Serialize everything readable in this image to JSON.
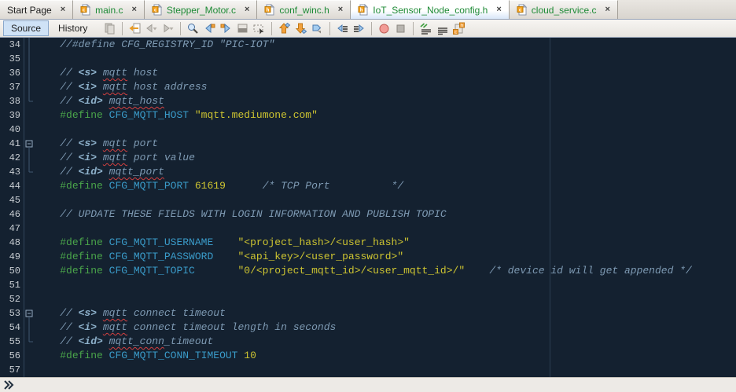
{
  "window_title": "MPLAB X IDE editor",
  "tabs": [
    {
      "label": "Start Page",
      "file_type": "none",
      "active": false,
      "close_label": "x"
    },
    {
      "label": "main.c",
      "file_type": "c",
      "active": false,
      "close_label": "x"
    },
    {
      "label": "Stepper_Motor.c",
      "file_type": "c",
      "active": false,
      "close_label": "x"
    },
    {
      "label": "conf_winc.h",
      "file_type": "h",
      "active": false,
      "close_label": "x"
    },
    {
      "label": "IoT_Sensor_Node_config.h",
      "file_type": "h",
      "active": true,
      "close_label": "x"
    },
    {
      "label": "cloud_service.c",
      "file_type": "c",
      "active": false,
      "close_label": "x"
    }
  ],
  "toolbar": {
    "source_label": "Source",
    "history_label": "History",
    "icons": [
      "diff",
      "sep",
      "last-edit-location",
      "back",
      "forward",
      "sep",
      "find",
      "find-previous",
      "find-next",
      "toggle-highlight-search",
      "rectangular-selection",
      "sep",
      "previous-bookmark",
      "next-bookmark",
      "toggle-bookmark",
      "sep",
      "shift-left",
      "shift-right",
      "sep",
      "start-macro-recording",
      "stop-macro-recording",
      "sep",
      "comment",
      "uncomment",
      "toggle-header-source"
    ]
  },
  "colors": {
    "editor_background": "#142130",
    "comment": "#7e9ab3",
    "keyword": "#4aa54a",
    "macro_name": "#3a9bc9",
    "string_number": "#cdc431",
    "spell_error": "#d34040",
    "tab_modified_text": "#1d8a35",
    "active_tab_highlight": "#d8e6f8"
  },
  "editor": {
    "first_line": 34,
    "last_line": 57,
    "lines": [
      {
        "n": 34,
        "fold": "g",
        "segs": [
          {
            "t": "    //#define CFG_REGISTRY_ID \"PIC-IOT\"",
            "c": "cm"
          }
        ]
      },
      {
        "n": 35,
        "fold": "g",
        "segs": []
      },
      {
        "n": 36,
        "fold": "g",
        "segs": [
          {
            "t": "    ",
            "c": "pl"
          },
          {
            "t": "// ",
            "c": "cm"
          },
          {
            "t": "<s>",
            "c": "cm tag"
          },
          {
            "t": " ",
            "c": "cm"
          },
          {
            "t": "mqtt",
            "c": "cm sp"
          },
          {
            "t": " host",
            "c": "cm"
          }
        ]
      },
      {
        "n": 37,
        "fold": "g",
        "segs": [
          {
            "t": "    ",
            "c": "pl"
          },
          {
            "t": "// ",
            "c": "cm"
          },
          {
            "t": "<i>",
            "c": "cm tag"
          },
          {
            "t": " ",
            "c": "cm"
          },
          {
            "t": "mqtt",
            "c": "cm sp"
          },
          {
            "t": " host address",
            "c": "cm"
          }
        ]
      },
      {
        "n": 38,
        "fold": "end",
        "segs": [
          {
            "t": "    ",
            "c": "pl"
          },
          {
            "t": "// ",
            "c": "cm"
          },
          {
            "t": "<id>",
            "c": "cm tag"
          },
          {
            "t": " ",
            "c": "cm"
          },
          {
            "t": "mqtt_host",
            "c": "cm sp"
          }
        ]
      },
      {
        "n": 39,
        "fold": "",
        "segs": [
          {
            "t": "    ",
            "c": "pl"
          },
          {
            "t": "#define",
            "c": "kw"
          },
          {
            "t": " ",
            "c": "pl"
          },
          {
            "t": "CFG_MQTT_HOST",
            "c": "id"
          },
          {
            "t": " ",
            "c": "pl"
          },
          {
            "t": "\"mqtt.mediumone.com\"",
            "c": "str"
          }
        ]
      },
      {
        "n": 40,
        "fold": "",
        "segs": []
      },
      {
        "n": 41,
        "fold": "box",
        "segs": [
          {
            "t": "    ",
            "c": "pl"
          },
          {
            "t": "// ",
            "c": "cm"
          },
          {
            "t": "<s>",
            "c": "cm tag"
          },
          {
            "t": " ",
            "c": "cm"
          },
          {
            "t": "mqtt",
            "c": "cm sp"
          },
          {
            "t": " port",
            "c": "cm"
          }
        ]
      },
      {
        "n": 42,
        "fold": "g",
        "segs": [
          {
            "t": "    ",
            "c": "pl"
          },
          {
            "t": "// ",
            "c": "cm"
          },
          {
            "t": "<i>",
            "c": "cm tag"
          },
          {
            "t": " ",
            "c": "cm"
          },
          {
            "t": "mqtt",
            "c": "cm sp"
          },
          {
            "t": " port value",
            "c": "cm"
          }
        ]
      },
      {
        "n": 43,
        "fold": "end",
        "segs": [
          {
            "t": "    ",
            "c": "pl"
          },
          {
            "t": "// ",
            "c": "cm"
          },
          {
            "t": "<id>",
            "c": "cm tag"
          },
          {
            "t": " ",
            "c": "cm"
          },
          {
            "t": "mqtt_port",
            "c": "cm sp"
          }
        ]
      },
      {
        "n": 44,
        "fold": "",
        "segs": [
          {
            "t": "    ",
            "c": "pl"
          },
          {
            "t": "#define",
            "c": "kw"
          },
          {
            "t": " ",
            "c": "pl"
          },
          {
            "t": "CFG_MQTT_PORT",
            "c": "id"
          },
          {
            "t": " ",
            "c": "pl"
          },
          {
            "t": "61619",
            "c": "num"
          },
          {
            "t": "      ",
            "c": "pl"
          },
          {
            "t": "/* TCP Port          */",
            "c": "cm"
          }
        ]
      },
      {
        "n": 45,
        "fold": "",
        "segs": []
      },
      {
        "n": 46,
        "fold": "",
        "segs": [
          {
            "t": "    ",
            "c": "pl"
          },
          {
            "t": "// UPDATE THESE FIELDS WITH LOGIN INFORMATION AND PUBLISH TOPIC",
            "c": "cm"
          }
        ]
      },
      {
        "n": 47,
        "fold": "",
        "segs": []
      },
      {
        "n": 48,
        "fold": "",
        "segs": [
          {
            "t": "    ",
            "c": "pl"
          },
          {
            "t": "#define",
            "c": "kw"
          },
          {
            "t": " ",
            "c": "pl"
          },
          {
            "t": "CFG_MQTT_USERNAME",
            "c": "id"
          },
          {
            "t": "    ",
            "c": "pl"
          },
          {
            "t": "\"<project_hash>/<user_hash>\"",
            "c": "str"
          }
        ]
      },
      {
        "n": 49,
        "fold": "",
        "segs": [
          {
            "t": "    ",
            "c": "pl"
          },
          {
            "t": "#define",
            "c": "kw"
          },
          {
            "t": " ",
            "c": "pl"
          },
          {
            "t": "CFG_MQTT_PASSWORD",
            "c": "id"
          },
          {
            "t": "    ",
            "c": "pl"
          },
          {
            "t": "\"<api_key>/<user_password>\"",
            "c": "str"
          }
        ]
      },
      {
        "n": 50,
        "fold": "",
        "segs": [
          {
            "t": "    ",
            "c": "pl"
          },
          {
            "t": "#define",
            "c": "kw"
          },
          {
            "t": " ",
            "c": "pl"
          },
          {
            "t": "CFG_MQTT_TOPIC",
            "c": "id"
          },
          {
            "t": "       ",
            "c": "pl"
          },
          {
            "t": "\"0/<project_mqtt_id>/<user_mqtt_id>/\"",
            "c": "str"
          },
          {
            "t": "    ",
            "c": "pl"
          },
          {
            "t": "/* device id will get appended */",
            "c": "cm"
          }
        ]
      },
      {
        "n": 51,
        "fold": "",
        "segs": []
      },
      {
        "n": 52,
        "fold": "",
        "segs": []
      },
      {
        "n": 53,
        "fold": "box",
        "segs": [
          {
            "t": "    ",
            "c": "pl"
          },
          {
            "t": "// ",
            "c": "cm"
          },
          {
            "t": "<s>",
            "c": "cm tag"
          },
          {
            "t": " ",
            "c": "cm"
          },
          {
            "t": "mqtt",
            "c": "cm sp"
          },
          {
            "t": " connect timeout",
            "c": "cm"
          }
        ]
      },
      {
        "n": 54,
        "fold": "g",
        "segs": [
          {
            "t": "    ",
            "c": "pl"
          },
          {
            "t": "// ",
            "c": "cm"
          },
          {
            "t": "<i>",
            "c": "cm tag"
          },
          {
            "t": " ",
            "c": "cm"
          },
          {
            "t": "mqtt",
            "c": "cm sp"
          },
          {
            "t": " connect timeout length in seconds",
            "c": "cm"
          }
        ]
      },
      {
        "n": 55,
        "fold": "end",
        "segs": [
          {
            "t": "    ",
            "c": "pl"
          },
          {
            "t": "// ",
            "c": "cm"
          },
          {
            "t": "<id>",
            "c": "cm tag"
          },
          {
            "t": " ",
            "c": "cm"
          },
          {
            "t": "mqtt_conn",
            "c": "cm sp"
          },
          {
            "t": "_timeout",
            "c": "cm"
          }
        ]
      },
      {
        "n": 56,
        "fold": "",
        "segs": [
          {
            "t": "    ",
            "c": "pl"
          },
          {
            "t": "#define",
            "c": "kw"
          },
          {
            "t": " ",
            "c": "pl"
          },
          {
            "t": "CFG_MQTT_CONN_TIMEOUT",
            "c": "id"
          },
          {
            "t": " ",
            "c": "pl"
          },
          {
            "t": "10",
            "c": "num"
          }
        ]
      },
      {
        "n": 57,
        "fold": "",
        "segs": []
      }
    ]
  },
  "breadcrumb": {
    "icon": "expand-chevron"
  }
}
